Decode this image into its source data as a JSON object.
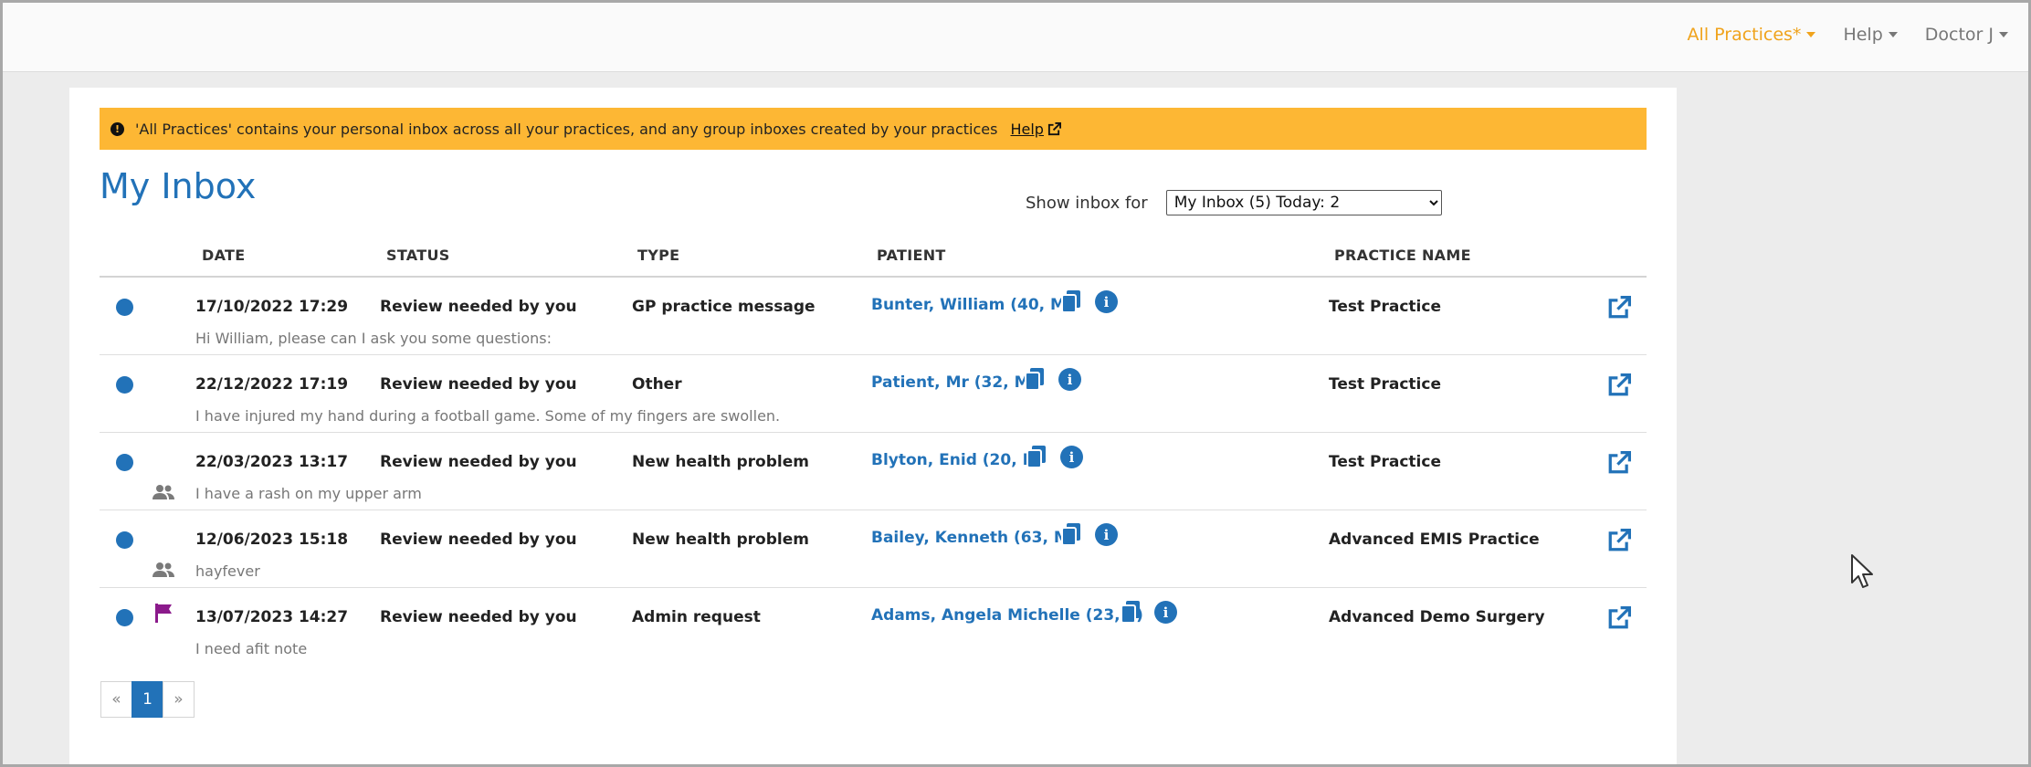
{
  "topnav": {
    "practices_label": "All Practices*",
    "help_label": "Help",
    "user_label": "Doctor J"
  },
  "alert": {
    "message": "'All Practices' contains your personal inbox across all your practices, and any group inboxes created by your practices",
    "help_link": "Help"
  },
  "page": {
    "title": "My Inbox",
    "filter_label": "Show inbox for",
    "filter_selected": "My Inbox (5) Today: 2"
  },
  "table": {
    "headers": {
      "date": "DATE",
      "status": "STATUS",
      "type": "TYPE",
      "patient": "PATIENT",
      "practice": "PRACTICE NAME"
    },
    "rows": [
      {
        "date": "17/10/2022 17:29",
        "status": "Review needed by you",
        "type": "GP practice message",
        "patient": "Bunter, William (40, M)",
        "practice": "Test Practice",
        "preview": "Hi William, please can I ask you some questions:"
      },
      {
        "date": "22/12/2022 17:19",
        "status": "Review needed by you",
        "type": "Other",
        "patient": "Patient, Mr (32, M)",
        "practice": "Test Practice",
        "preview": "I have injured my hand during a football game. Some of my fingers are swollen."
      },
      {
        "date": "22/03/2023 13:17",
        "status": "Review needed by you",
        "type": "New health problem",
        "patient": "Blyton, Enid (20, F)",
        "practice": "Test Practice",
        "preview": "I have a rash on my upper arm"
      },
      {
        "date": "12/06/2023 15:18",
        "status": "Review needed by you",
        "type": "New health problem",
        "patient": "Bailey, Kenneth (63, M)",
        "practice": "Advanced EMIS Practice",
        "preview": "hayfever"
      },
      {
        "date": "13/07/2023 14:27",
        "status": "Review needed by you",
        "type": "Admin request",
        "patient": "Adams, Angela Michelle (23, F)",
        "practice": "Advanced Demo Surgery",
        "preview": "I need afit note"
      }
    ]
  },
  "pagination": {
    "prev": "«",
    "current": "1",
    "next": "»"
  },
  "colors": {
    "accent": "#2272b8",
    "alert_bg": "#fdb734",
    "active_nav": "#f0a31c",
    "flag": "#8b1a8b"
  }
}
